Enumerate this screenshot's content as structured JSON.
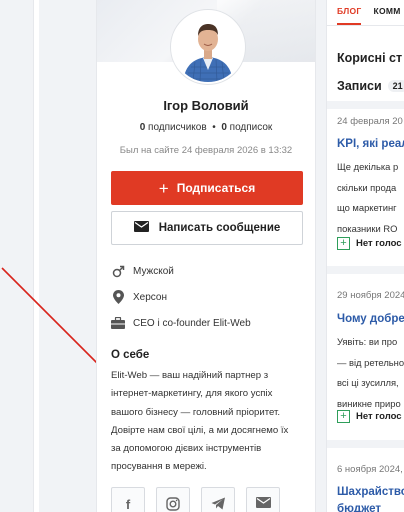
{
  "profile": {
    "name": "Ігор Воловий",
    "followers_count": "0",
    "followers_label": "подписчиков",
    "separator": "•",
    "following_count": "0",
    "following_label": "подписок",
    "last_seen": "Был на сайте 24 февраля 2026 в 13:32",
    "subscribe_label": "Подписаться",
    "message_label": "Написать сообщение",
    "gender": "Мужской",
    "city": "Херсон",
    "position": "CEO i co-founder Elit-Web",
    "about_title": "О себе",
    "about_lines": [
      "Elit-Web — ваш надійний партнер з",
      "інтернет-маркетингу, для якого успіх",
      "вашого бізнесу — головний пріоритет.",
      "Довірте нам свої цілі, а ми досягнемо їх",
      "за допомогою дієвих інструментів",
      "просування в мережі."
    ],
    "social_icons": [
      "facebook-icon",
      "instagram-icon",
      "telegram-icon",
      "email-icon"
    ]
  },
  "right_panel": {
    "tab_blog": "БЛОГ",
    "tab_comments": "КОММ",
    "title": "Корисні ст",
    "subtitle": "Записи",
    "subtitle_count": "21",
    "posts": [
      {
        "date": "24 февраля 20",
        "title": "KPI, які реал",
        "excerpt": [
          "Ще декілька р",
          "скільки прода",
          "що маркетинг",
          "показники RO"
        ],
        "vote_label": "Нет голос"
      },
      {
        "date": "29 ноября 2024",
        "title": "Чому добре",
        "excerpt": [
          "Уявіть: ви про",
          "— від ретельно",
          "всі ці зусилля,",
          "виникне приро"
        ],
        "vote_label": "Нет голос"
      },
      {
        "date": "6 ноября 2024,",
        "title": "Шахрайство",
        "title2": "бюджет"
      }
    ]
  },
  "colors": {
    "accent_red": "#e03a24",
    "link_blue": "#2d5ba8",
    "vote_green": "#2e9e5a"
  }
}
